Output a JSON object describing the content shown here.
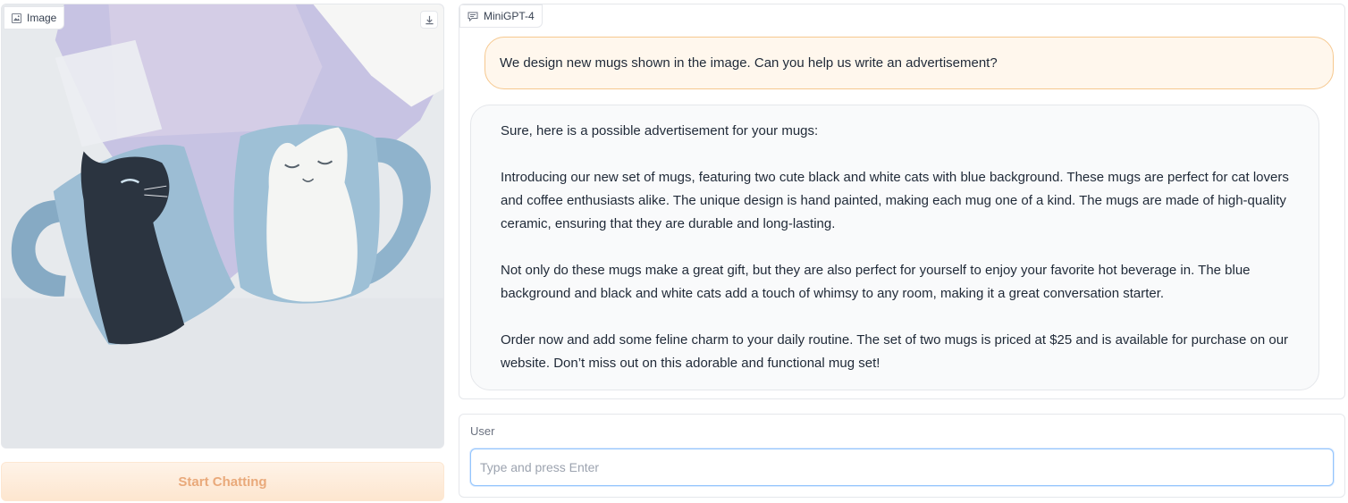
{
  "image_panel": {
    "label": "Image",
    "label_icon": "image-icon",
    "download_icon": "download-icon"
  },
  "start_button": {
    "label": "Start Chatting"
  },
  "chatbot": {
    "label": "MiniGPT-4",
    "label_icon": "chat-bubble-icon",
    "messages": [
      {
        "role": "user",
        "text": "We design new mugs shown in the image. Can you help us write an advertisement?"
      },
      {
        "role": "bot",
        "paragraphs": [
          "Sure, here is a possible advertisement for your mugs:",
          "Introducing our new set of mugs, featuring two cute black and white cats with blue background. These mugs are perfect for cat lovers and coffee enthusiasts alike. The unique design is hand painted, making each mug one of a kind. The mugs are made of high-quality ceramic, ensuring that they are durable and long-lasting.",
          "Not only do these mugs make a great gift, but they are also perfect for yourself to enjoy your favorite hot beverage in. The blue background and black and white cats add a touch of whimsy to any room, making it a great conversation starter.",
          "Order now and add some feline charm to your daily routine. The set of two mugs is priced at $25 and is available for purchase on our website. Don’t miss out on this adorable and functional mug set!"
        ]
      }
    ]
  },
  "user_input": {
    "label": "User",
    "value": "",
    "placeholder": "Type and press Enter"
  },
  "colors": {
    "accent_orange": "#f6c88f",
    "user_bubble": "#fff7ed",
    "bot_bubble": "#f9fafb",
    "focus_blue": "#93c5fd"
  }
}
